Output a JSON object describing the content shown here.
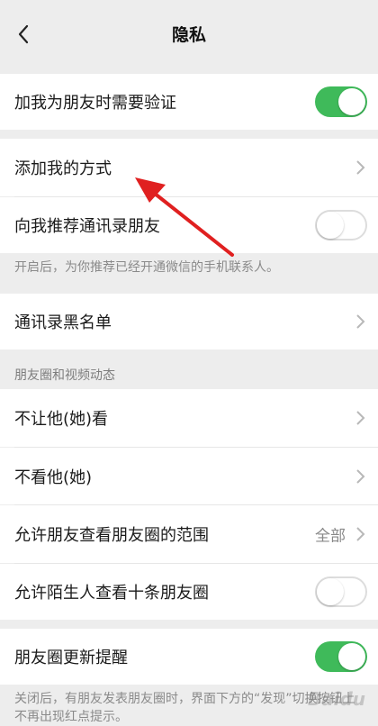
{
  "header": {
    "title": "隐私",
    "back_icon": "chevron-left-icon"
  },
  "rows": {
    "verify": {
      "label": "加我为朋友时需要验证",
      "toggle": "on"
    },
    "add_method": {
      "label": "添加我的方式"
    },
    "recommend": {
      "label": "向我推荐通讯录朋友",
      "toggle": "off"
    },
    "blacklist": {
      "label": "通讯录黑名单"
    },
    "not_let_see": {
      "label": "不让他(她)看"
    },
    "not_see": {
      "label": "不看他(她)"
    },
    "range": {
      "label": "允许朋友查看朋友圈的范围",
      "value": "全部"
    },
    "stranger": {
      "label": "允许陌生人查看十条朋友圈",
      "toggle": "off"
    },
    "moments_remind": {
      "label": "朋友圈更新提醒",
      "toggle": "on"
    }
  },
  "hints": {
    "recommend": "开启后，为你推荐已经开通微信的手机联系人。",
    "moments_remind": "关闭后，有朋友发表朋友圈时，界面下方的“发现”切换按钮上不再出现红点提示。"
  },
  "sections": {
    "moments": "朋友圈和视频动态"
  },
  "watermark": "Baidu",
  "colors": {
    "accent_green": "#3fba5a",
    "annotation_red": "#e02020",
    "background": "#ededed"
  }
}
